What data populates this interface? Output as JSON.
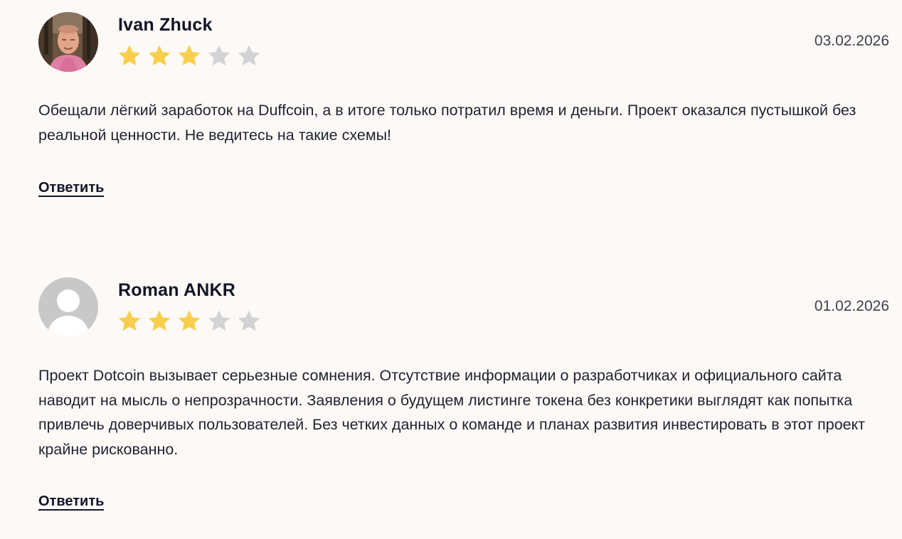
{
  "reviews": [
    {
      "author": "Ivan Zhuck",
      "date": "03.02.2026",
      "rating": 3,
      "max_rating": 5,
      "avatar": "photo-avatar",
      "text": "Обещали лёгкий заработок на Duffcoin, а в итоге только потратил время и деньги. Проект оказался пустышкой без реальной ценности. Не ведитесь на такие схемы!",
      "reply_label": "Ответить"
    },
    {
      "author": "Roman ANKR",
      "date": "01.02.2026",
      "rating": 3,
      "max_rating": 5,
      "avatar": "default-user-avatar",
      "text": "Проект Dotcoin вызывает серьезные сомнения. Отсутствие информации о разработчиках и официального сайта наводит на мысль о непрозрачности. Заявления о будущем листинге токена без конкретики выглядят как попытка привлечь доверчивых пользователей. Без четких данных о команде и планах развития инвестировать в этот проект крайне рискованно.",
      "reply_label": "Ответить"
    }
  ],
  "colors": {
    "background": "#fdf9f6",
    "star_filled": "#f7cf4c",
    "star_empty": "#d3d3d6",
    "text": "#1e2230"
  }
}
